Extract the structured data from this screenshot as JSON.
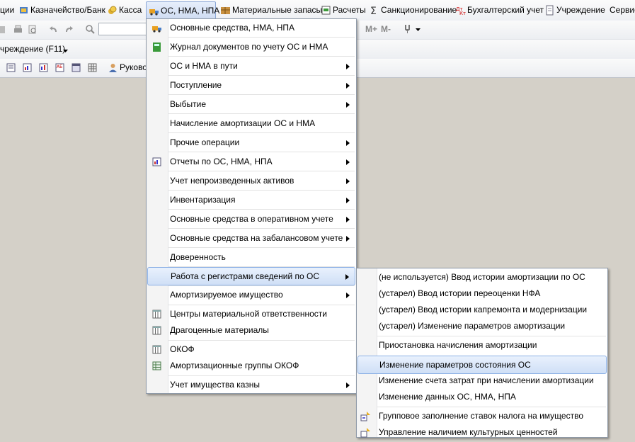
{
  "menubar": {
    "items": [
      {
        "label": "ции"
      },
      {
        "label": "Казначейство/Банк"
      },
      {
        "label": "Касса"
      },
      {
        "label": "ОС, НМА, НПА"
      },
      {
        "label": "Материальные запасы"
      },
      {
        "label": "Расчеты"
      },
      {
        "label": "Санкционирование"
      },
      {
        "label": "Бухгалтерский учет"
      },
      {
        "label": "Учреждение"
      },
      {
        "label": "Сервис"
      }
    ]
  },
  "toolbar": {
    "calc_m_plus": "M+",
    "calc_m_minus": "M-",
    "institution_label": "чреждение (F11)",
    "manager_label": "Руково"
  },
  "main_menu": {
    "items": [
      {
        "label": "Основные средства, НМА, НПА",
        "icon": "truck-icon"
      },
      {
        "label": "Журнал документов по учету ОС и НМА",
        "icon": "journal-icon"
      },
      {
        "label": "ОС и НМА в пути"
      },
      {
        "label": "Поступление"
      },
      {
        "label": "Выбытие"
      },
      {
        "label": "Начисление амортизации ОС и НМА"
      },
      {
        "label": "Прочие операции"
      },
      {
        "label": "Отчеты по ОС, НМА, НПА",
        "icon": "report-icon"
      },
      {
        "label": "Учет непроизведенных активов"
      },
      {
        "label": "Инвентаризация"
      },
      {
        "label": "Основные средства в оперативном учете"
      },
      {
        "label": "Основные средства на забалансовом учете"
      },
      {
        "label": "Доверенность"
      },
      {
        "label": "Работа с регистрами сведений по ОС"
      },
      {
        "label": "Амортизируемое имущество"
      },
      {
        "label": "Центры материальной ответственности",
        "icon": "table-icon"
      },
      {
        "label": "Драгоценные материалы",
        "icon": "table-icon"
      },
      {
        "label": "ОКОФ",
        "icon": "table-icon"
      },
      {
        "label": "Амортизационные группы ОКОФ",
        "icon": "grid-icon"
      },
      {
        "label": "Учет имущества казны"
      }
    ]
  },
  "sub_menu": {
    "items": [
      {
        "label": "(не используется) Ввод истории амортизации по ОС"
      },
      {
        "label": "(устарел) Ввод истории переоценки НФА"
      },
      {
        "label": "(устарел) Ввод истории капремонта и модернизации"
      },
      {
        "label": "(устарел) Изменение параметров амортизации"
      },
      {
        "label": "Приостановка начисления амортизации"
      },
      {
        "label": "Изменение параметров состояния ОС"
      },
      {
        "label": "Изменение счета затрат при начислении амортизации"
      },
      {
        "label": "Изменение данных ОС, НМА, НПА"
      },
      {
        "label": "Групповое заполнение ставок налога на имущество"
      },
      {
        "label": "Управление наличием культурных ценностей"
      }
    ]
  },
  "colors": {
    "desktop": "#d4d0c8",
    "highlight_border": "#8bb0e6"
  }
}
